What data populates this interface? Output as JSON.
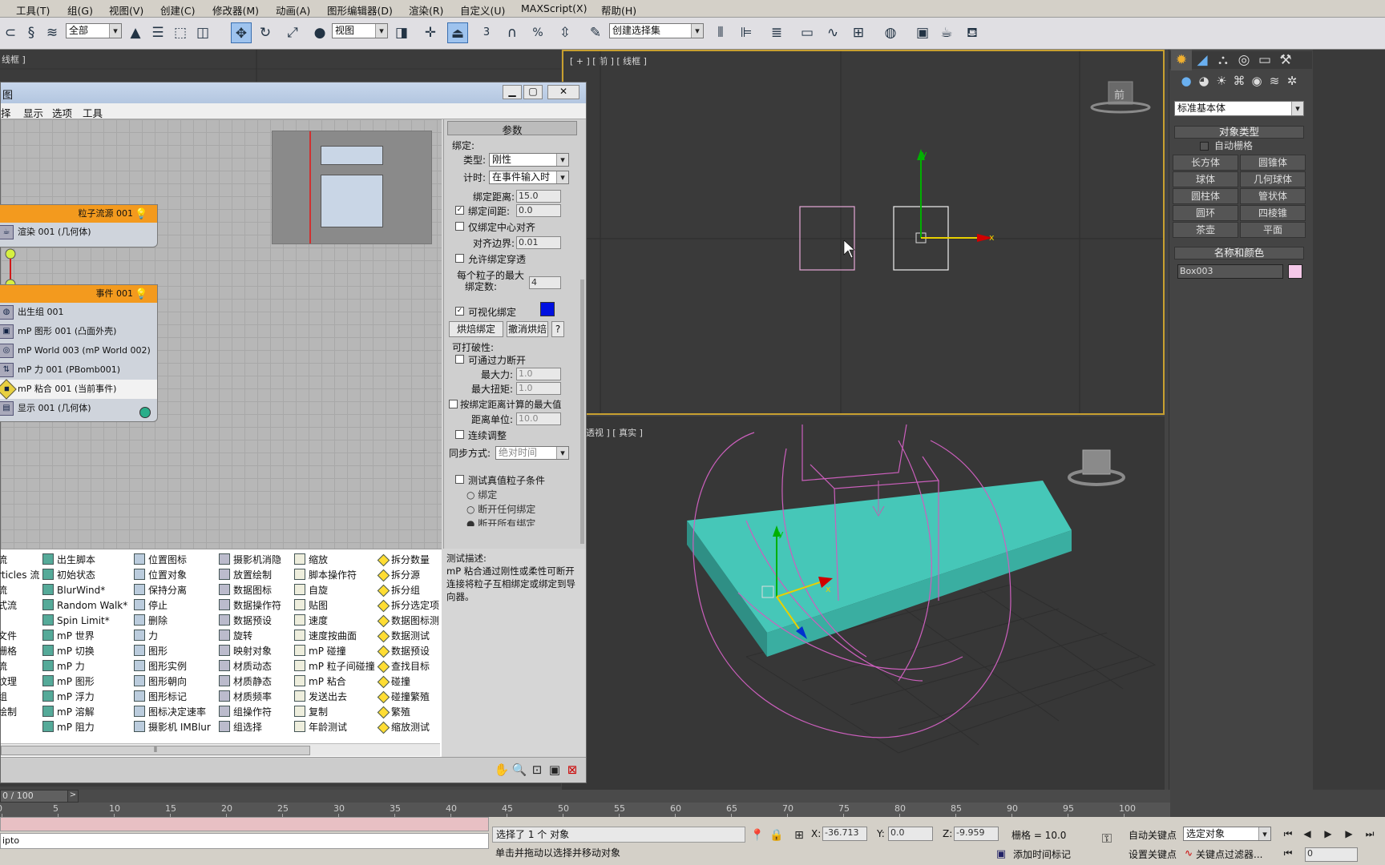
{
  "menubar": [
    "工具(T)",
    "组(G)",
    "视图(V)",
    "创建(C)",
    "修改器(M)",
    "动画(A)",
    "图形编辑器(D)",
    "渲染(R)",
    "自定义(U)",
    "MAXScript(X)",
    "帮助(H)"
  ],
  "toolbar": {
    "filter": "全部",
    "refcoord": "视图",
    "selset": "创建选择集",
    "snap3": "3",
    "angle": "%",
    "colors": {
      "bg": "#e0dfe3"
    }
  },
  "viewports": {
    "top_left_label": "线框 ]",
    "front_label": "[ + ] [ 前 ] [ 线框 ]",
    "front_cube": "前",
    "persp_label": "透视 ] [ 真实 ]",
    "axis_x": "x",
    "axis_y": "y"
  },
  "pf": {
    "menu": [
      "择",
      "显示",
      "选项",
      "工具"
    ],
    "title": "图",
    "source": {
      "title": "粒子流源 001",
      "row": "渲染 001 (几何体)"
    },
    "event": {
      "title": "事件 001",
      "rows": [
        "出生组 001",
        "mP 图形 001 (凸面外壳)",
        "mP World 003 (mP World 002)",
        "mP 力 001 (PBomb001)",
        "mP 粘合 001 (当前事件)",
        "显示 001 (几何体)"
      ]
    },
    "params": {
      "head": "参数",
      "bind": "绑定:",
      "type_label": "类型:",
      "type_value": "刚性",
      "timing_label": "计时:",
      "timing_value": "在事件输入时",
      "dist_label": "绑定距离:",
      "dist_value": "15.0",
      "gap_label": "绑定间距:",
      "gap_value": "0.0",
      "center": "仅绑定中心对齐",
      "align_label": "对齐边界:",
      "align_value": "0.01",
      "allow": "允许绑定穿透",
      "max1": "每个粒子的最大",
      "max2": "绑定数:",
      "max_value": "4",
      "visual": "可视化绑定",
      "bake": "烘焙绑定",
      "unbake": "撤消烘焙",
      "q": "?",
      "breakable": "可打破性:",
      "force_break": "可通过力断开",
      "maxforce_label": "最大力:",
      "maxforce_value": "1.0",
      "maxtorque_label": "最大扭矩:",
      "maxtorque_value": "1.0",
      "bydist": "按绑定距离计算的最大值",
      "distunit_label": "距离单位:",
      "distunit_value": "10.0",
      "cont": "连续调整",
      "sync_label": "同步方式:",
      "sync_value": "绝对时间",
      "test": "测试真值粒子条件",
      "r1": "绑定",
      "r2": "断开任何绑定",
      "r3": "断开所有绑定"
    },
    "desc_title": "测试描述:",
    "desc": "mP 粘合通过刚性或柔性可断开连接将粒子互相绑定或绑定到导向器。",
    "depot": [
      [
        "流",
        "rticles 流",
        "流",
        "式流",
        "",
        "文件",
        "栅格",
        "流",
        "纹理",
        "组",
        "绘制"
      ],
      [
        "出生脚本",
        "初始状态",
        "BlurWind*",
        "Random Walk*",
        "Spin Limit*",
        "mP 世界",
        "mP 切换",
        "mP 力",
        "mP 图形",
        "mP 浮力",
        "mP 溶解",
        "mP 阻力"
      ],
      [
        "位置图标",
        "位置对象",
        "保持分离",
        "停止",
        "删除",
        "力",
        "图形",
        "图形实例",
        "图形朝向",
        "图形标记",
        "图标决定速率",
        "摄影机 IMBlur"
      ],
      [
        "摄影机消隐",
        "放置绘制",
        "数据图标",
        "数据操作符",
        "数据预设",
        "旋转",
        "映射对象",
        "材质动态",
        "材质静态",
        "材质频率",
        "组操作符",
        "组选择"
      ],
      [
        "缩放",
        "脚本操作符",
        "自旋",
        "贴图",
        "速度",
        "速度按曲面",
        "mP 碰撞",
        "mP 粒子间碰撞",
        "mP 粘合",
        "发送出去",
        "复制",
        "年龄测试"
      ],
      [
        "拆分数量",
        "拆分源",
        "拆分组",
        "拆分选定项",
        "数据图标测",
        "数据测试",
        "数据预设",
        "查找目标",
        "碰撞",
        "碰撞繁殖",
        "繁殖",
        "缩放测试"
      ]
    ]
  },
  "cmd": {
    "category": "标准基本体",
    "rollout_objtype": "对象类型",
    "autogrid": "自动栅格",
    "buttons": [
      "长方体",
      "圆锥体",
      "球体",
      "几何球体",
      "圆柱体",
      "管状体",
      "圆环",
      "四棱锥",
      "茶壶",
      "平面"
    ],
    "rollout_name": "名称和颜色",
    "name": "Box003",
    "color": "#f4c8e8"
  },
  "timeline": {
    "frame": "0 / 100",
    "ticks": [
      "0",
      "5",
      "10",
      "15",
      "20",
      "25",
      "30",
      "35",
      "40",
      "45",
      "50",
      "55",
      "60",
      "65",
      "70",
      "75",
      "80",
      "85",
      "90",
      "95",
      "100"
    ]
  },
  "status": {
    "selected": "选择了 1 个 对象",
    "hint": "单击并拖动以选择并移动对象",
    "x_label": "X:",
    "x": "-36.713",
    "y_label": "Y:",
    "y": "0.0",
    "z_label": "Z:",
    "z": "-9.959",
    "grid": "栅格 = 10.0",
    "autokey": "自动关键点",
    "setkey": "设置关键点",
    "keymode": "选定对象",
    "keyfilter": "关键点过滤器...",
    "addtime": "添加时间标记",
    "script": "ipto",
    "frame": "0"
  }
}
